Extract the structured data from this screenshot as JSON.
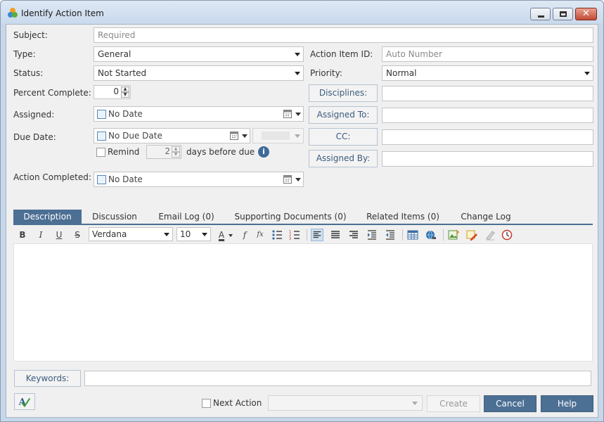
{
  "window": {
    "title": "Identify Action Item",
    "icon": "colored-circles-app-icon"
  },
  "form": {
    "subject": {
      "label": "Subject:",
      "placeholder": "Required"
    },
    "type": {
      "label": "Type:",
      "value": "General"
    },
    "status": {
      "label": "Status:",
      "value": "Not Started"
    },
    "percent_complete": {
      "label": "Percent Complete:",
      "value": "0"
    },
    "assigned": {
      "label": "Assigned:",
      "value": "No Date"
    },
    "due_date": {
      "label": "Due Date:",
      "value": "No Due Date"
    },
    "remind": {
      "label": "Remind",
      "days": "2",
      "suffix": "days before due"
    },
    "action_completed": {
      "label": "Action Completed:",
      "value": "No Date"
    },
    "action_item_id": {
      "label": "Action Item ID:",
      "placeholder": "Auto Number"
    },
    "priority": {
      "label": "Priority:",
      "value": "Normal"
    },
    "disciplines": {
      "label": "Disciplines:"
    },
    "assigned_to": {
      "label": "Assigned To:"
    },
    "cc": {
      "label": "CC:"
    },
    "assigned_by": {
      "label": "Assigned By:"
    }
  },
  "tabs": [
    {
      "label": "Description",
      "active": true
    },
    {
      "label": "Discussion"
    },
    {
      "label": "Email Log (0)"
    },
    {
      "label": "Supporting Documents (0)"
    },
    {
      "label": "Related Items (0)"
    },
    {
      "label": "Change Log"
    }
  ],
  "toolbar": {
    "bold": "B",
    "italic": "I",
    "underline": "U",
    "strike": "S",
    "font": "Verdana",
    "size": "10",
    "font_color_glyph": "A",
    "function_glyph": "f",
    "formula_glyph": "fx"
  },
  "footer": {
    "keywords_label": "Keywords:",
    "next_action_label": "Next Action",
    "create": "Create",
    "cancel": "Cancel",
    "help": "Help"
  },
  "colors": {
    "accent": "#4c6f94",
    "button_text": "#3b5b7e",
    "primary_button": "#4c6f94"
  }
}
